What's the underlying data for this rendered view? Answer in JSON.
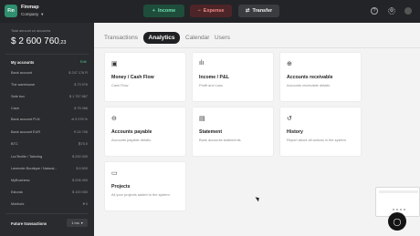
{
  "topbar": {
    "logo_text": "Fin",
    "app_name": "Finmap",
    "company_label": "Company",
    "income_label": "Income",
    "expense_label": "Expense",
    "transfer_label": "Transfer",
    "income_icon": "plus-icon",
    "expense_icon": "minus-icon",
    "transfer_icon": "transfer-icon"
  },
  "sidebar": {
    "total_label": "Total amount on accounts",
    "total_amount": "$ 2 600 760",
    "total_decimals": ",23",
    "accounts_title": "My accounts",
    "edit_label": "Edit",
    "accounts": [
      {
        "name": "Bank account",
        "value": "$ 247 176 R"
      },
      {
        "name": "The warehouse",
        "value": "$ 73 976"
      },
      {
        "name": "Safe box",
        "value": "$ 1 757 867"
      },
      {
        "name": "Cash",
        "value": "$ 75 066"
      },
      {
        "name": "Bank account PLN",
        "value": "zł 9 076 %"
      },
      {
        "name": "Bank account EUR",
        "value": "€ 24 706"
      },
      {
        "name": "BTC",
        "value": "₿70.0"
      },
      {
        "name": "LuxTextile / Tailoring",
        "value": "$ 200 000"
      },
      {
        "name": "Lavender Boutique / Natural...",
        "value": "$ 6 600"
      },
      {
        "name": "MyBusiness",
        "value": "$ 206 400"
      },
      {
        "name": "Estonia",
        "value": "$ 100 000"
      },
      {
        "name": "Mobilork",
        "value": "₴ 0"
      }
    ],
    "future_label": "Future transactions",
    "future_period": "1 mo"
  },
  "tabs": [
    {
      "label": "Transactions"
    },
    {
      "label": "Analytics"
    },
    {
      "label": "Calendar"
    },
    {
      "label": "Users"
    }
  ],
  "cards": [
    {
      "icon": "calendar-icon",
      "glyph": "▣",
      "title": "Money / Cash Flow",
      "desc": "Cash Flow"
    },
    {
      "icon": "bar-chart-icon",
      "glyph": "ılı",
      "title": "Income / P&L",
      "desc": "Profit and Loss"
    },
    {
      "icon": "receivable-icon",
      "glyph": "⊕",
      "title": "Accounts receivable",
      "desc": "Accounts receivable details"
    },
    {
      "icon": "payable-icon",
      "glyph": "⊖",
      "title": "Accounts payable",
      "desc": "Accounts payable details"
    },
    {
      "icon": "statement-icon",
      "glyph": "▤",
      "title": "Statement",
      "desc": "Bank accounts statements"
    },
    {
      "icon": "history-icon",
      "glyph": "↺",
      "title": "History",
      "desc": "Report about all actions in the system"
    },
    {
      "icon": "folder-icon",
      "glyph": "▭",
      "title": "Projects",
      "desc": "All your projects added to the system"
    }
  ]
}
